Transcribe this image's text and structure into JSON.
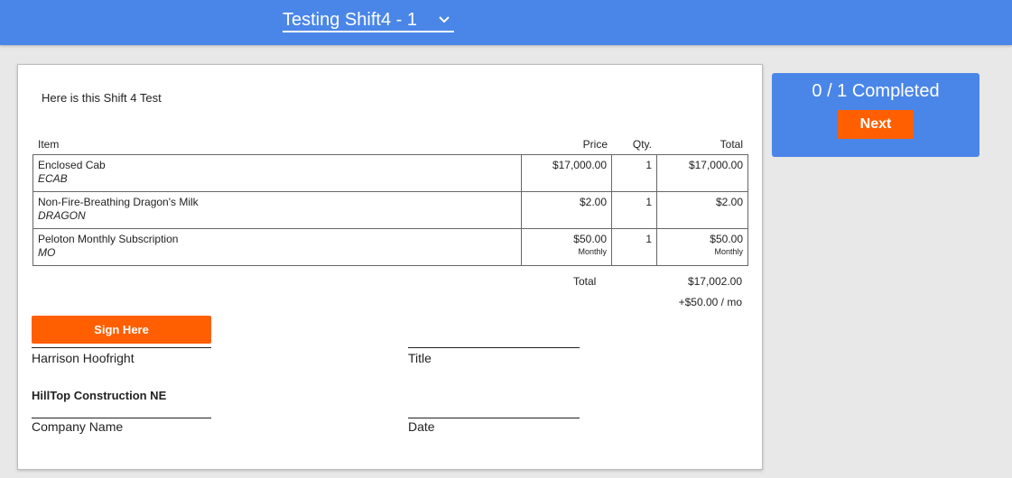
{
  "header": {
    "document_select": {
      "value": "Testing Shift4 - 1",
      "icon": "chevron-down-icon"
    }
  },
  "document": {
    "intro": "Here is this Shift 4 Test",
    "columns": {
      "item": "Item",
      "price": "Price",
      "qty": "Qty.",
      "total": "Total"
    },
    "rows": [
      {
        "name": "Enclosed Cab",
        "code": "ECAB",
        "price": "$17,000.00",
        "price_freq": "",
        "qty": "1",
        "total": "$17,000.00",
        "total_freq": ""
      },
      {
        "name": "Non-Fire-Breathing Dragon's Milk",
        "code": "DRAGON",
        "price": "$2.00",
        "price_freq": "",
        "qty": "1",
        "total": "$2.00",
        "total_freq": ""
      },
      {
        "name": "Peloton Monthly Subscription",
        "code": "MO",
        "price": "$50.00",
        "price_freq": "Monthly",
        "qty": "1",
        "total": "$50.00",
        "total_freq": "Monthly"
      }
    ],
    "totals": {
      "label": "Total",
      "value": "$17,002.00",
      "recurring": "+$50.00 / mo"
    },
    "signature": {
      "sign_button": "Sign Here",
      "signer_name": "Harrison Hoofright",
      "title_label": "Title",
      "company_value": "HillTop Construction NE",
      "company_label": "Company Name",
      "date_label": "Date"
    }
  },
  "sidebar": {
    "progress": "0 / 1 Completed",
    "next_button": "Next"
  },
  "colors": {
    "primary": "#4a86e8",
    "accent": "#ff5f00",
    "background": "#e8e8e8"
  }
}
